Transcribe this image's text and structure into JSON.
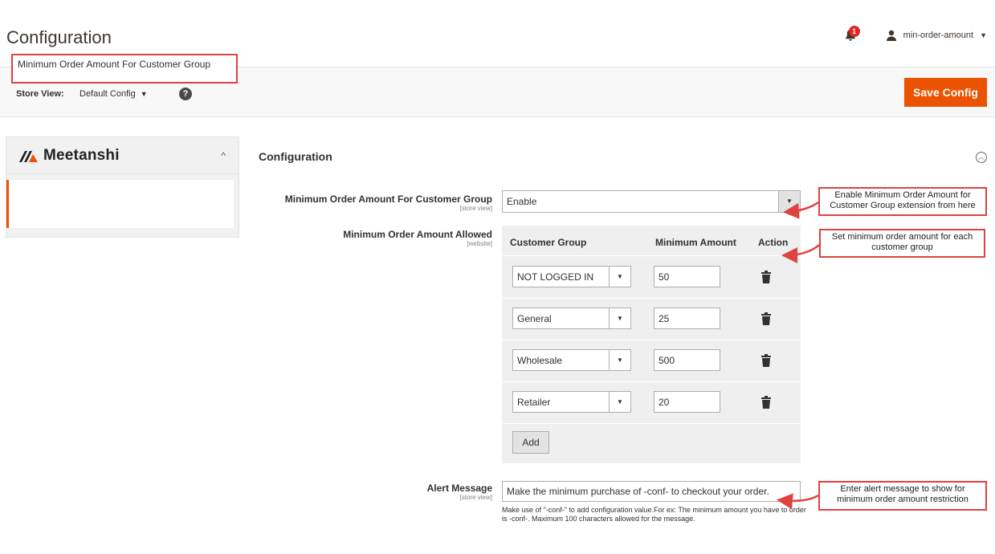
{
  "header": {
    "title": "Configuration",
    "notification_count": "1",
    "username": "min-order-amount",
    "bell_icon": "bell-icon",
    "user_icon": "user-icon"
  },
  "store_bar": {
    "label": "Store View:",
    "value": "Default Config",
    "help_icon": "question-circle-icon",
    "save_label": "Save Config",
    "save_color": "#eb5202"
  },
  "sidebar": {
    "brand": "Meetanshi",
    "items": [
      {
        "label": "Minimum Order Amount For Customer Group"
      }
    ]
  },
  "section": {
    "title": "Configuration"
  },
  "fields": {
    "enable": {
      "label": "Minimum Order Amount For Customer Group",
      "scope": "[store view]",
      "value": "Enable"
    },
    "allowed": {
      "label": "Minimum Order Amount Allowed",
      "scope": "[website]",
      "columns": [
        "Customer Group",
        "Minimum Amount",
        "Action"
      ],
      "rows": [
        {
          "group": "NOT LOGGED IN",
          "amount": "50"
        },
        {
          "group": "General",
          "amount": "25"
        },
        {
          "group": "Wholesale",
          "amount": "500"
        },
        {
          "group": "Retailer",
          "amount": "20"
        }
      ],
      "add_label": "Add"
    },
    "alert": {
      "label": "Alert Message",
      "scope": "[store view]",
      "value": "Make the minimum purchase of -conf- to checkout your order.",
      "note": "Make use of \"-conf-\" to add configuration value.For ex: The minimum amount you have to order is -conf-. Maximum 100 characters allowed for the message."
    }
  },
  "callouts": [
    {
      "text": "Enable Minimum Order Amount for Customer Group extension from here"
    },
    {
      "text": "Set minimum order amount for each customer group"
    },
    {
      "text": "Enter alert message to show for minimum order amount restriction"
    }
  ],
  "colors": {
    "accent": "#eb5202",
    "callout_border": "#e04141"
  }
}
